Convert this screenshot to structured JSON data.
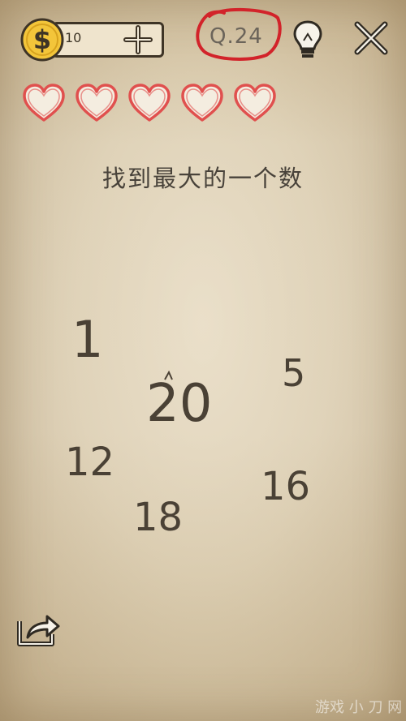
{
  "header": {
    "coin_icon": "dollar-coin-icon",
    "coin_symbol": "$",
    "coins": "10",
    "add_icon": "plus-icon",
    "level": "Q.24",
    "hint_icon": "lightbulb-icon",
    "close_icon": "close-icon"
  },
  "lives": {
    "count": 5,
    "icon": "heart-outline-icon",
    "color": "#e0504e"
  },
  "question": "找到最大的一个数",
  "numbers": [
    {
      "value": "1"
    },
    {
      "value": "5"
    },
    {
      "value": "20"
    },
    {
      "value": "12"
    },
    {
      "value": "16"
    },
    {
      "value": "18"
    }
  ],
  "footer": {
    "share_icon": "share-export-icon"
  },
  "watermark": "游戏 小 刀 网"
}
